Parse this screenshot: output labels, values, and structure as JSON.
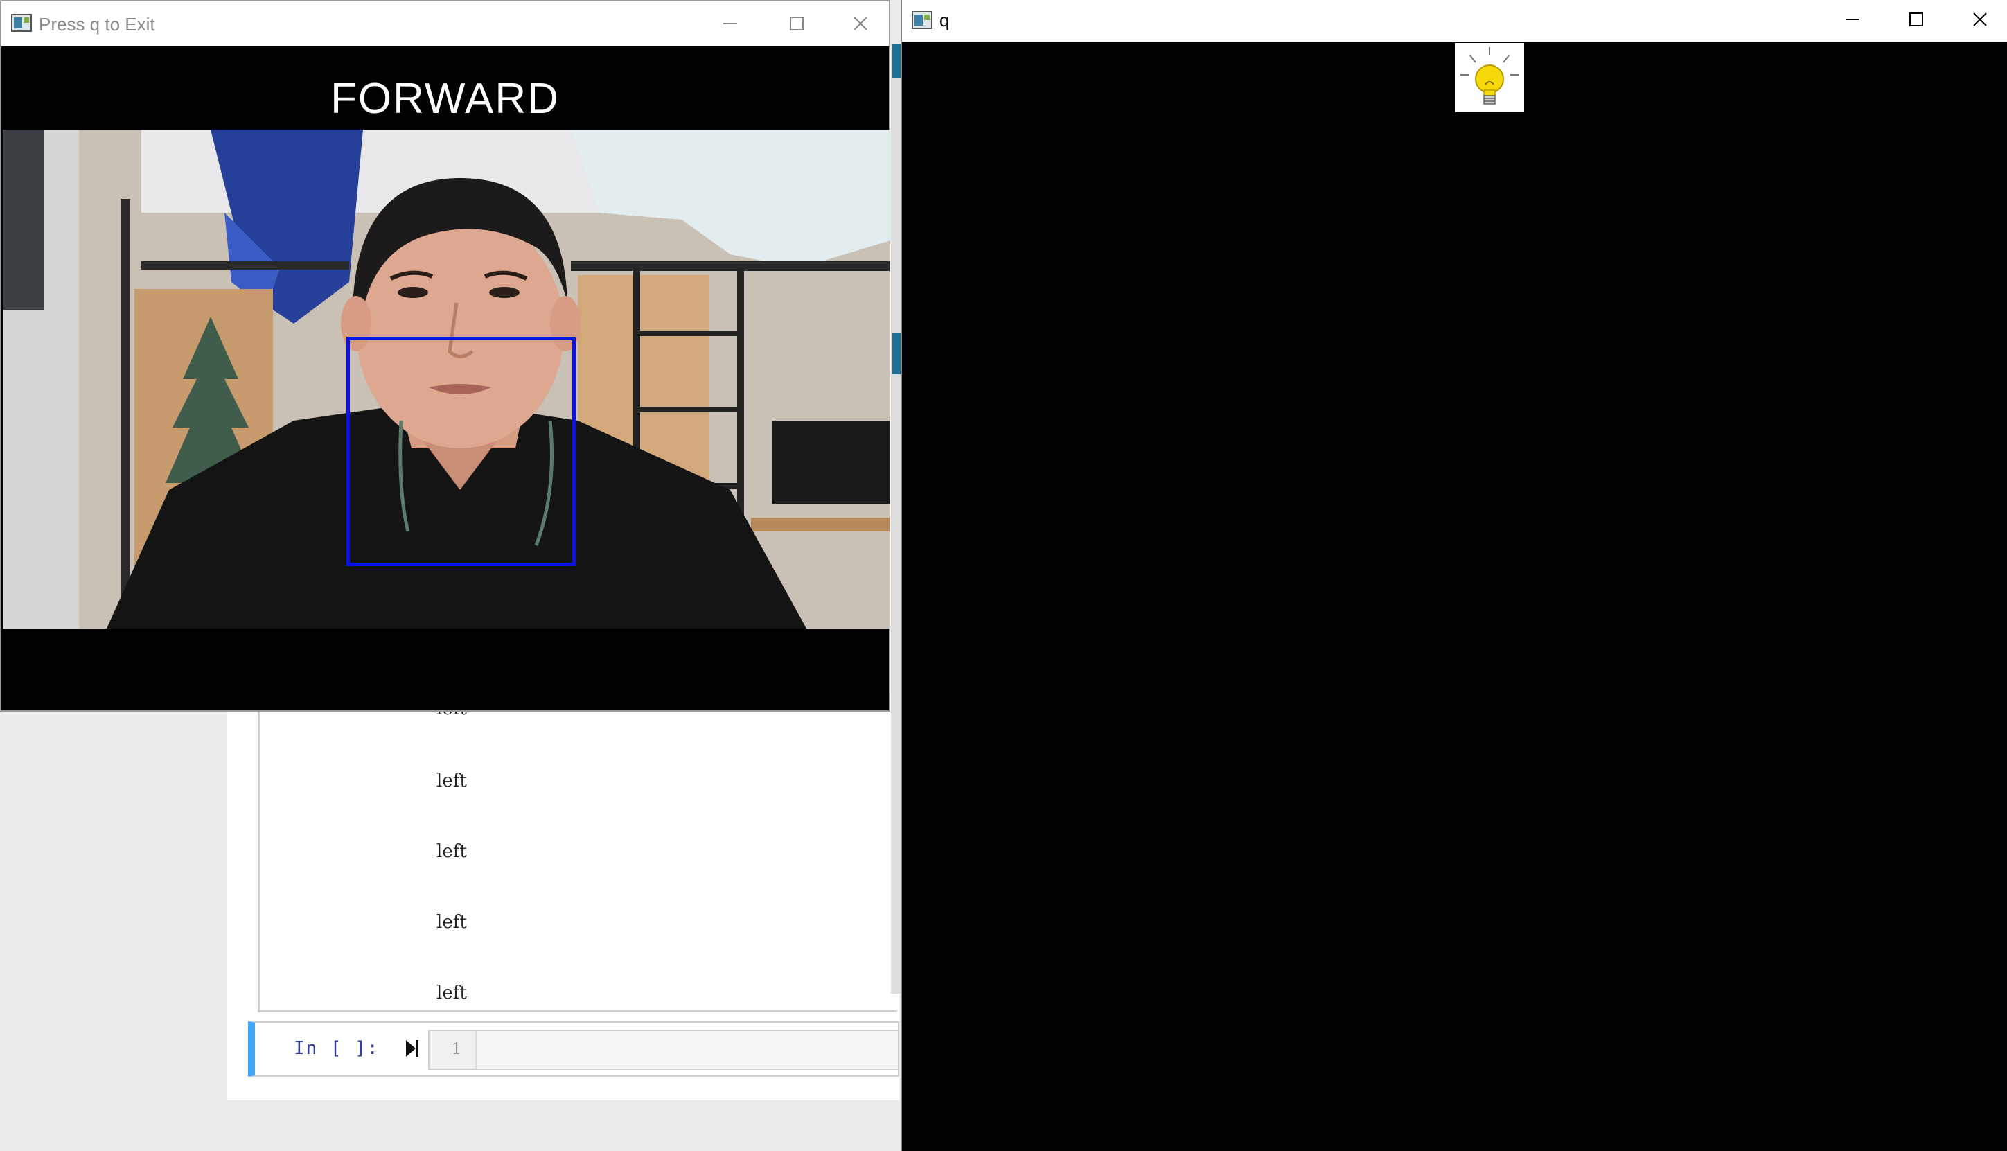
{
  "camera_window": {
    "title": "Press q to Exit",
    "overlay_text": "FORWARD",
    "controls": {
      "minimize": "minimize",
      "maximize": "maximize",
      "close": "close"
    }
  },
  "q_window": {
    "title": "q",
    "image_icon": "lightbulb-icon"
  },
  "notebook": {
    "output_lines": [
      "left",
      "left",
      "left",
      "left",
      "left"
    ],
    "cell_prompt": "In [ ]:",
    "line_number": "1"
  },
  "colors": {
    "face_box": "#0a12e6",
    "cell_accent": "#42a5f5",
    "bulb": "#f5d90a"
  }
}
